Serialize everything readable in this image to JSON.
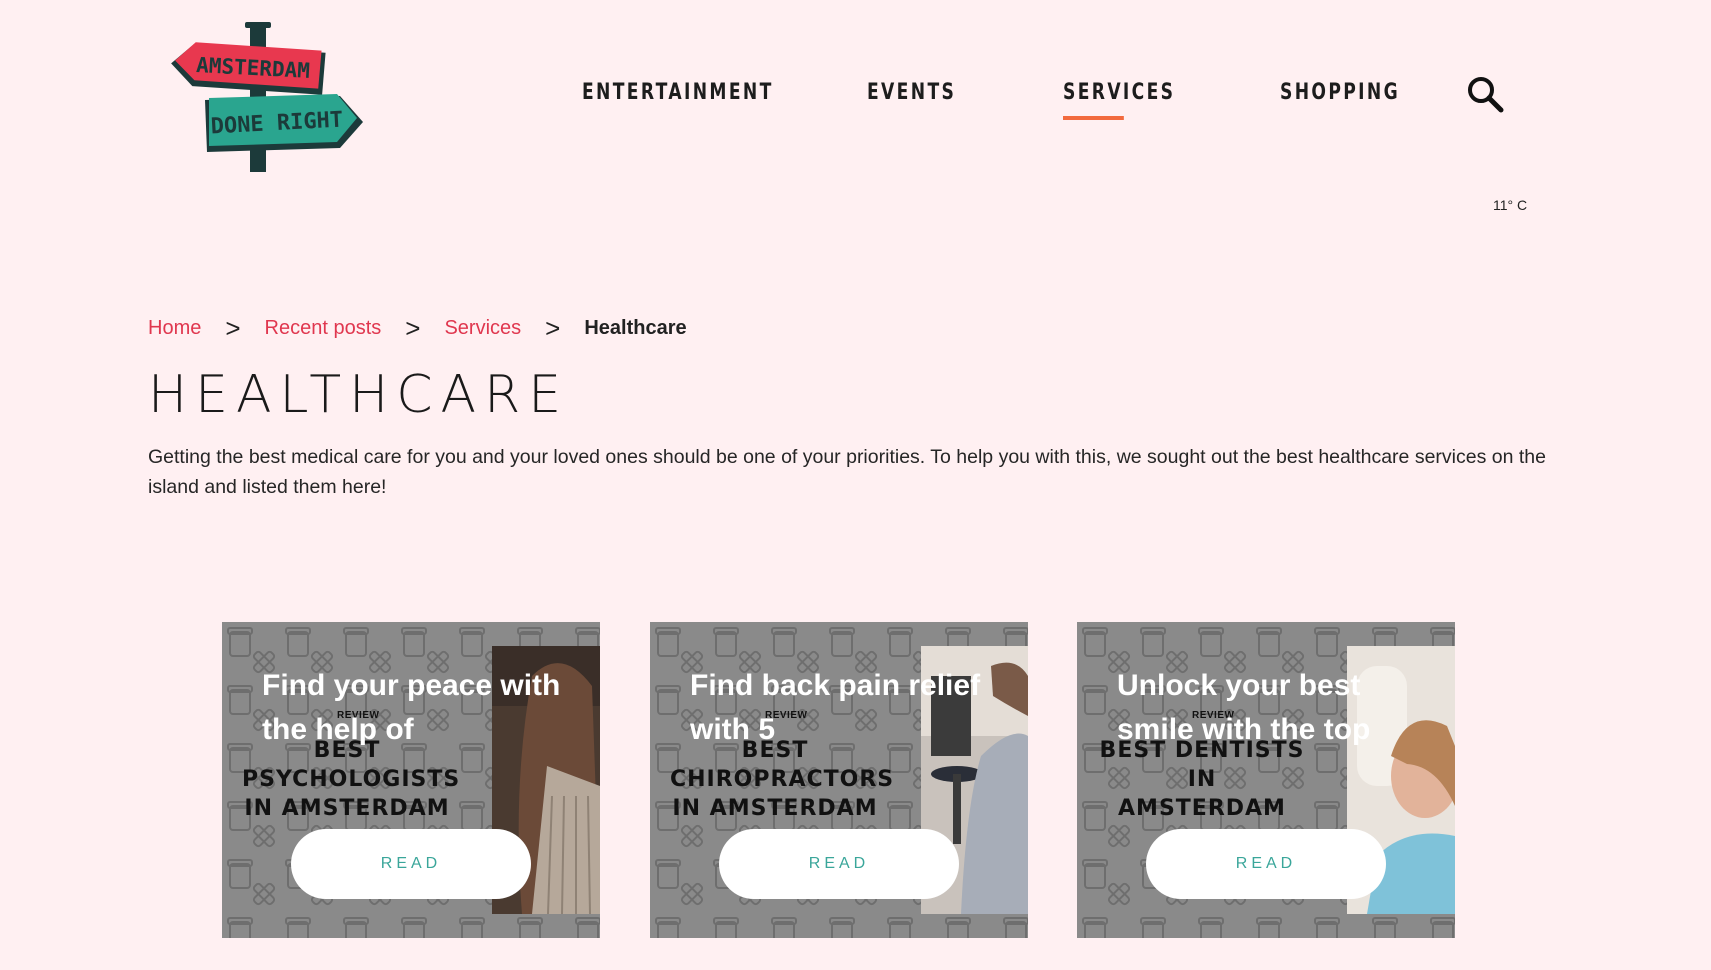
{
  "header": {
    "logo": {
      "line1": "AMSTERDAM",
      "line2": "DONE RIGHT"
    },
    "nav": [
      {
        "label": "ENTERTAINMENT",
        "active": false
      },
      {
        "label": "EVENTS",
        "active": false
      },
      {
        "label": "SERVICES",
        "active": true
      },
      {
        "label": "SHOPPING",
        "active": false
      }
    ],
    "search_icon": "search-icon",
    "temperature": "11° C"
  },
  "breadcrumb": {
    "items": [
      "Home",
      "Recent posts",
      "Services"
    ],
    "separator": ">",
    "current": "Healthcare"
  },
  "page": {
    "title": "HEALTHCARE",
    "intro": "Getting the best medical care for you and your loved ones should be one of your priorities. To help you with this, we sought out the best healthcare services on the island and listed them here!"
  },
  "cards": [
    {
      "title": "Find your peace with the help of",
      "review_label": "REVIEW",
      "cover_lines": [
        "BEST",
        "PSYCHOLOGISTS",
        "IN AMSTERDAM"
      ],
      "button": "READ"
    },
    {
      "title": "Find back pain relief with 5",
      "review_label": "REVIEW",
      "cover_lines": [
        "BEST",
        "CHIROPRACTORS",
        "IN AMSTERDAM"
      ],
      "button": "READ"
    },
    {
      "title": "Unlock your best smile with the top",
      "review_label": "REVIEW",
      "cover_lines": [
        "BEST DENTISTS IN",
        "AMSTERDAM"
      ],
      "button": "READ"
    }
  ],
  "colors": {
    "background": "#fff0f2",
    "link": "#e0374f",
    "nav_active_underline": "#f26a3e",
    "button_text": "#3aa69a",
    "logo_red": "#e8384f",
    "logo_teal": "#2aa58f",
    "logo_dark": "#1c3a3a"
  }
}
